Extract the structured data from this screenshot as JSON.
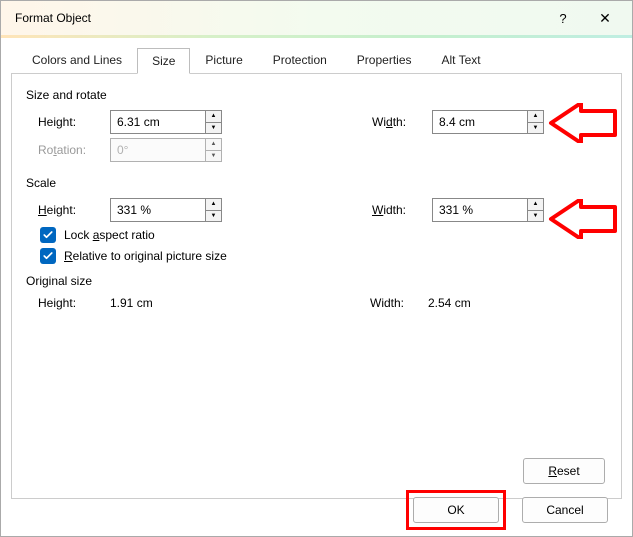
{
  "title": "Format Object",
  "tabs": {
    "colors": "Colors and Lines",
    "size": "Size",
    "picture": "Picture",
    "protection": "Protection",
    "properties": "Properties",
    "alttext": "Alt Text"
  },
  "groups": {
    "sizerotate": "Size and rotate",
    "scale": "Scale",
    "original": "Original size"
  },
  "labels": {
    "height_e": "H",
    "height_rest": "eight:",
    "width_d": "d",
    "width_pre": "Wi",
    "width_post": "th:",
    "rotation_pre": "Ro",
    "rotation_u": "t",
    "rotation_post": "ation:",
    "scale_height_u": "H",
    "scale_height_rest": "eight:",
    "scale_width_u": "W",
    "scale_width_rest": "idth:",
    "lock_pre": "Lock ",
    "lock_u": "a",
    "lock_post": "spect ratio",
    "rel_u": "R",
    "rel_post": "elative to original picture size",
    "orig_height": "Height:",
    "orig_width": "Width:"
  },
  "values": {
    "height": "6.31 cm",
    "width": "8.4 cm",
    "rotation": "0°",
    "scale_height": "331 %",
    "scale_width": "331 %",
    "orig_height": "1.91 cm",
    "orig_width": "2.54 cm"
  },
  "buttons": {
    "reset": "Reset",
    "ok": "OK",
    "cancel": "Cancel",
    "help": "?",
    "close": "✕"
  }
}
